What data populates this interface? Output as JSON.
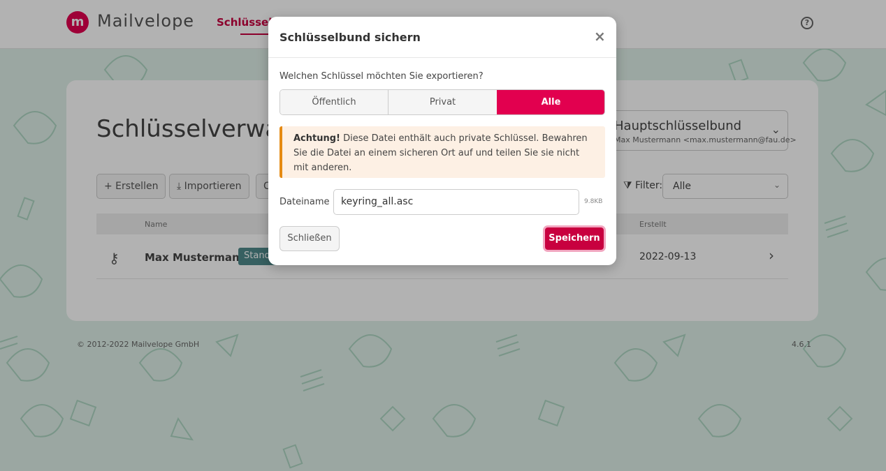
{
  "navbar": {
    "logo_letter": "m",
    "app_name": "Mailvelope",
    "active_tab": "Schlüsselverwaltung",
    "help_icon": "question-circle-icon"
  },
  "main": {
    "title": "Schlüsselverwaltung",
    "keyring": {
      "name": "Hauptschlüsselbund",
      "user": "Max Mustermann <max.mustermann@fau.de>"
    },
    "toolbar": {
      "create_label": "+ Erstellen",
      "import_label": "⤓ Importieren",
      "more_label": "C",
      "filter_label": "Filter:",
      "filter_value": "Alle"
    },
    "table": {
      "headers": [
        "Name",
        "Erstellt"
      ],
      "rows": [
        {
          "name": "Max Mustermann",
          "badge": "Standard",
          "created": "2022-09-13"
        }
      ]
    }
  },
  "footer": {
    "copyright": "© 2012-2022  Mailvelope GmbH",
    "version": "4.6.1"
  },
  "modal": {
    "title": "Schlüsselbund sichern",
    "close": "×",
    "question": "Welchen Schlüssel möchten Sie exportieren?",
    "options": [
      "Öffentlich",
      "Privat",
      "Alle"
    ],
    "selected_option": "Alle",
    "alert_strong": "Achtung!",
    "alert_text": " Diese Datei enthält auch private Schlüssel. Bewahren Sie die Datei an einem sicheren Ort auf und teilen Sie sie nicht mit anderen.",
    "filename_label": "Dateiname",
    "filename_value": "keyring_all.asc",
    "file_size": "9.8KB",
    "close_button": "Schließen",
    "save_button": "Speichern"
  },
  "colors": {
    "accent": "#e2004f",
    "accent_dark": "#c8003f",
    "background": "#dff0e8",
    "warning_border": "#e58a12",
    "warning_bg": "#fdf0e4"
  }
}
